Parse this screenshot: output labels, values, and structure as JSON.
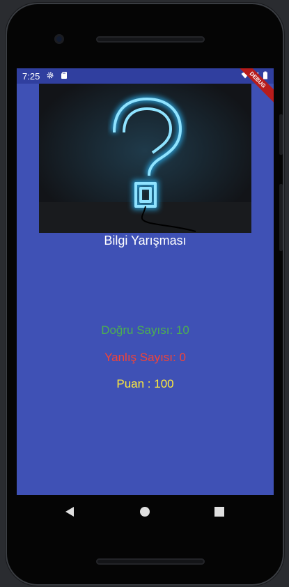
{
  "status_bar": {
    "time": "7:25",
    "left_icons": [
      "gear-icon",
      "sd-card-icon"
    ],
    "right_icons": [
      "wifi-icon",
      "signal-icon",
      "battery-icon"
    ],
    "debug_banner": "DEBUG"
  },
  "app": {
    "title": "Bilgi Yarışması",
    "hero_image": "neon-question-mark",
    "correct_label": "Doğru Sayısı: 10",
    "wrong_label": "Yanlış Sayısı: 0",
    "score_label": "Puan : 100",
    "colors": {
      "background": "#3f51b5",
      "status_bar": "#303f9f",
      "correct": "#4caf50",
      "wrong": "#f44336",
      "score": "#ffeb3b",
      "title": "#ffffff"
    }
  },
  "nav_bar": {
    "back": "back-icon",
    "home": "home-icon",
    "recents": "recents-icon"
  }
}
